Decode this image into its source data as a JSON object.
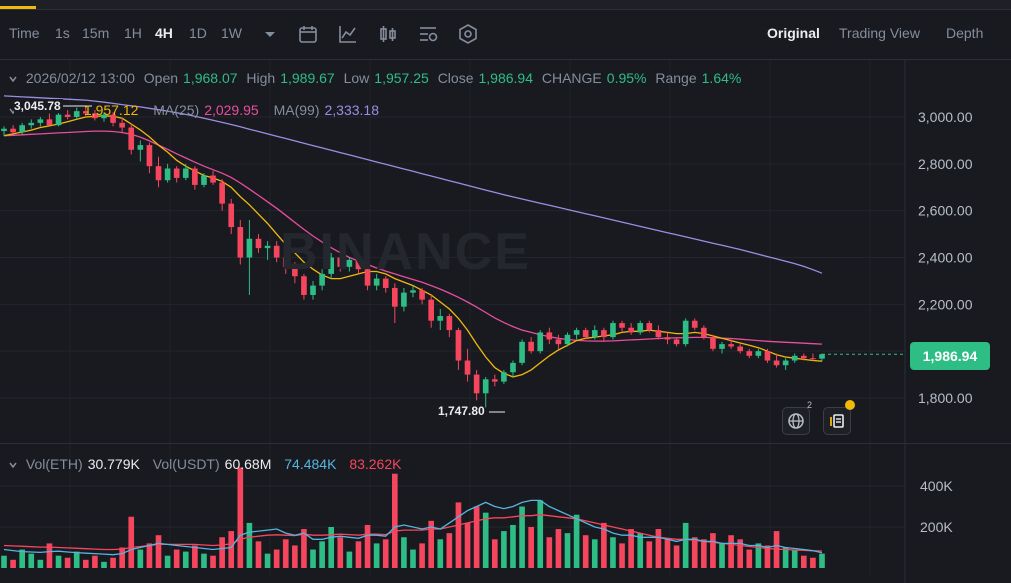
{
  "toolbar": {
    "intervals": [
      "Time",
      "1s",
      "15m",
      "1H",
      "4H",
      "1D",
      "1W"
    ],
    "active_interval": "4H",
    "views": [
      "Original",
      "Trading View",
      "Depth"
    ],
    "active_view": "Original"
  },
  "ohlc": {
    "datetime": "2026/02/12 13:00",
    "open_label": "Open",
    "open": "1,968.07",
    "high_label": "High",
    "high": "1,989.67",
    "low_label": "Low",
    "low": "1,957.25",
    "close_label": "Close",
    "close": "1,986.94",
    "change_label": "CHANGE",
    "change": "0.95%",
    "range_label": "Range",
    "range": "1.64%"
  },
  "ma": {
    "ma7_value": "1,957.12",
    "ma25_label": "MA(25)",
    "ma25_value": "2,029.95",
    "ma99_label": "MA(99)",
    "ma99_value": "2,333.18"
  },
  "volume_header": {
    "eth_label": "Vol(ETH)",
    "eth_value": "30.779K",
    "usdt_label": "Vol(USDT)",
    "usdt_value": "60.68M",
    "ma1_value": "74.484K",
    "ma2_value": "83.262K"
  },
  "price_tag": "1,986.94",
  "high_marker": "3,045.78",
  "low_marker": "1,747.80",
  "watermark": "BINANCE",
  "badge_count": "2",
  "colors": {
    "up": "#2ebd85",
    "down": "#f6465d",
    "ma7": "#f0b90b",
    "ma25": "#e84e9f",
    "ma99": "#9c8de4",
    "vol_ma1": "#56b4e0",
    "vol_ma2": "#f6465d",
    "background": "#181a20"
  },
  "chart_data": {
    "type": "candlestick",
    "y_ticks": [
      "3,000.00",
      "2,800.00",
      "2,600.00",
      "2,400.00",
      "2,200.00",
      "2,000.00",
      "1,800.00"
    ],
    "y_tick_values": [
      3000,
      2800,
      2600,
      2400,
      2200,
      2000,
      1800
    ],
    "ylim": [
      1640,
      3120
    ],
    "vol_ticks": [
      "400K",
      "200K"
    ],
    "vol_tick_values": [
      400,
      200
    ],
    "vol_ylim": [
      0,
      540
    ],
    "candles": [
      [
        2940,
        2960,
        2920,
        2950
      ],
      [
        2950,
        2965,
        2930,
        2935
      ],
      [
        2935,
        2975,
        2925,
        2965
      ],
      [
        2965,
        2990,
        2950,
        2975
      ],
      [
        2975,
        3000,
        2960,
        2990
      ],
      [
        2990,
        3015,
        2975,
        2965
      ],
      [
        2965,
        3020,
        2960,
        3010
      ],
      [
        3010,
        3030,
        2990,
        3000
      ],
      [
        3000,
        3040,
        2990,
        3025
      ],
      [
        3025,
        3046,
        3005,
        3015
      ],
      [
        3015,
        3030,
        2985,
        2995
      ],
      [
        2995,
        3020,
        2980,
        3010
      ],
      [
        3010,
        3020,
        2960,
        2975
      ],
      [
        2975,
        2995,
        2930,
        2955
      ],
      [
        2955,
        2970,
        2840,
        2860
      ],
      [
        2860,
        2900,
        2810,
        2880
      ],
      [
        2880,
        2890,
        2760,
        2790
      ],
      [
        2790,
        2830,
        2700,
        2730
      ],
      [
        2730,
        2800,
        2720,
        2780
      ],
      [
        2780,
        2790,
        2720,
        2740
      ],
      [
        2740,
        2800,
        2730,
        2780
      ],
      [
        2780,
        2790,
        2690,
        2710
      ],
      [
        2710,
        2760,
        2700,
        2750
      ],
      [
        2750,
        2770,
        2710,
        2720
      ],
      [
        2720,
        2735,
        2600,
        2630
      ],
      [
        2630,
        2650,
        2500,
        2530
      ],
      [
        2530,
        2560,
        2370,
        2400
      ],
      [
        2400,
        2560,
        2240,
        2480
      ],
      [
        2480,
        2500,
        2420,
        2440
      ],
      [
        2440,
        2470,
        2390,
        2450
      ],
      [
        2450,
        2470,
        2380,
        2400
      ],
      [
        2400,
        2420,
        2330,
        2360
      ],
      [
        2360,
        2380,
        2290,
        2320
      ],
      [
        2320,
        2330,
        2220,
        2240
      ],
      [
        2240,
        2300,
        2220,
        2280
      ],
      [
        2280,
        2350,
        2260,
        2330
      ],
      [
        2330,
        2420,
        2310,
        2400
      ],
      [
        2400,
        2410,
        2340,
        2360
      ],
      [
        2360,
        2400,
        2340,
        2390
      ],
      [
        2390,
        2400,
        2330,
        2350
      ],
      [
        2350,
        2360,
        2260,
        2280
      ],
      [
        2280,
        2330,
        2260,
        2310
      ],
      [
        2310,
        2320,
        2250,
        2270
      ],
      [
        2270,
        2290,
        2120,
        2190
      ],
      [
        2190,
        2270,
        2170,
        2250
      ],
      [
        2250,
        2280,
        2230,
        2260
      ],
      [
        2260,
        2270,
        2200,
        2220
      ],
      [
        2220,
        2240,
        2100,
        2130
      ],
      [
        2130,
        2180,
        2090,
        2150
      ],
      [
        2150,
        2160,
        2060,
        2090
      ],
      [
        2090,
        2100,
        1920,
        1960
      ],
      [
        1960,
        2010,
        1870,
        1900
      ],
      [
        1900,
        1920,
        1790,
        1820
      ],
      [
        1820,
        1890,
        1760,
        1880
      ],
      [
        1880,
        1900,
        1850,
        1870
      ],
      [
        1870,
        1920,
        1860,
        1910
      ],
      [
        1910,
        1960,
        1890,
        1950
      ],
      [
        1950,
        2050,
        1940,
        2040
      ],
      [
        2040,
        2060,
        1990,
        2000
      ],
      [
        2000,
        2090,
        1990,
        2080
      ],
      [
        2080,
        2100,
        2030,
        2050
      ],
      [
        2050,
        2070,
        2010,
        2030
      ],
      [
        2030,
        2080,
        2020,
        2070
      ],
      [
        2070,
        2100,
        2050,
        2090
      ],
      [
        2090,
        2100,
        2050,
        2060
      ],
      [
        2060,
        2110,
        2050,
        2090
      ],
      [
        2090,
        2100,
        2040,
        2060
      ],
      [
        2060,
        2130,
        2050,
        2120
      ],
      [
        2120,
        2130,
        2080,
        2100
      ],
      [
        2100,
        2120,
        2070,
        2080
      ],
      [
        2080,
        2130,
        2070,
        2120
      ],
      [
        2120,
        2130,
        2080,
        2090
      ],
      [
        2090,
        2110,
        2050,
        2060
      ],
      [
        2060,
        2080,
        2030,
        2050
      ],
      [
        2050,
        2060,
        2020,
        2030
      ],
      [
        2030,
        2140,
        2020,
        2130
      ],
      [
        2130,
        2140,
        2090,
        2100
      ],
      [
        2100,
        2110,
        2050,
        2060
      ],
      [
        2060,
        2070,
        2000,
        2010
      ],
      [
        2010,
        2040,
        1990,
        2030
      ],
      [
        2030,
        2050,
        2010,
        2020
      ],
      [
        2020,
        2030,
        1990,
        2000
      ],
      [
        2000,
        2010,
        1970,
        1980
      ],
      [
        1980,
        2010,
        1970,
        2000
      ],
      [
        2000,
        2010,
        1950,
        1960
      ],
      [
        1960,
        1990,
        1930,
        1940
      ],
      [
        1940,
        1970,
        1920,
        1960
      ],
      [
        1960,
        1990,
        1950,
        1980
      ],
      [
        1980,
        1990,
        1960,
        1970
      ],
      [
        1970,
        1990,
        1960,
        1968
      ],
      [
        1968,
        1990,
        1957,
        1987
      ]
    ],
    "volumes": [
      60,
      40,
      90,
      70,
      40,
      120,
      60,
      50,
      80,
      40,
      60,
      30,
      50,
      100,
      250,
      90,
      120,
      160,
      60,
      90,
      80,
      110,
      70,
      60,
      150,
      180,
      490,
      220,
      130,
      70,
      90,
      140,
      110,
      190,
      90,
      130,
      200,
      150,
      80,
      130,
      210,
      120,
      140,
      460,
      150,
      90,
      120,
      230,
      140,
      170,
      320,
      220,
      300,
      270,
      140,
      180,
      210,
      300,
      200,
      330,
      150,
      190,
      170,
      260,
      160,
      140,
      220,
      150,
      120,
      190,
      170,
      130,
      190,
      140,
      110,
      220,
      150,
      140,
      170,
      120,
      160,
      140,
      90,
      120,
      110,
      180,
      100,
      90,
      60,
      50,
      70
    ],
    "ma7": [
      2920,
      2928,
      2936,
      2944,
      2955,
      2962,
      2970,
      2980,
      2990,
      3000,
      3003,
      3005,
      3003,
      2995,
      2970,
      2945,
      2915,
      2880,
      2850,
      2815,
      2790,
      2770,
      2750,
      2740,
      2725,
      2700,
      2660,
      2625,
      2585,
      2545,
      2500,
      2455,
      2420,
      2380,
      2350,
      2325,
      2310,
      2310,
      2320,
      2330,
      2340,
      2340,
      2330,
      2310,
      2295,
      2280,
      2260,
      2240,
      2210,
      2180,
      2140,
      2090,
      2030,
      1975,
      1930,
      1905,
      1890,
      1900,
      1920,
      1950,
      1980,
      2005,
      2025,
      2045,
      2055,
      2060,
      2065,
      2070,
      2080,
      2085,
      2085,
      2090,
      2085,
      2080,
      2075,
      2075,
      2080,
      2075,
      2065,
      2055,
      2045,
      2035,
      2025,
      2015,
      2000,
      1985,
      1975,
      1970,
      1965,
      1960,
      1957
    ],
    "ma25": [
      2920,
      2922,
      2924,
      2926,
      2928,
      2930,
      2932,
      2934,
      2936,
      2938,
      2940,
      2940,
      2938,
      2934,
      2926,
      2914,
      2898,
      2880,
      2862,
      2843,
      2825,
      2807,
      2790,
      2775,
      2760,
      2742,
      2718,
      2692,
      2665,
      2638,
      2610,
      2580,
      2550,
      2520,
      2492,
      2466,
      2442,
      2420,
      2400,
      2385,
      2370,
      2355,
      2342,
      2330,
      2318,
      2306,
      2294,
      2280,
      2265,
      2248,
      2230,
      2210,
      2188,
      2165,
      2142,
      2122,
      2105,
      2090,
      2080,
      2070,
      2062,
      2055,
      2050,
      2046,
      2044,
      2043,
      2043,
      2044,
      2046,
      2048,
      2050,
      2052,
      2054,
      2056,
      2057,
      2058,
      2059,
      2059,
      2058,
      2056,
      2054,
      2051,
      2048,
      2045,
      2042,
      2040,
      2038,
      2036,
      2034,
      2032,
      2030
    ],
    "ma99": [
      3090,
      3088,
      3086,
      3084,
      3082,
      3080,
      3078,
      3076,
      3074,
      3072,
      3068,
      3063,
      3058,
      3053,
      3048,
      3043,
      3037,
      3031,
      3025,
      3018,
      3011,
      3003,
      2995,
      2986,
      2977,
      2968,
      2958,
      2948,
      2938,
      2928,
      2918,
      2908,
      2898,
      2888,
      2878,
      2868,
      2858,
      2848,
      2838,
      2828,
      2818,
      2808,
      2798,
      2788,
      2778,
      2768,
      2758,
      2748,
      2738,
      2728,
      2718,
      2708,
      2698,
      2688,
      2678,
      2668,
      2659,
      2650,
      2641,
      2632,
      2623,
      2614,
      2605,
      2596,
      2587,
      2578,
      2569,
      2560,
      2551,
      2542,
      2533,
      2524,
      2515,
      2506,
      2497,
      2488,
      2479,
      2470,
      2461,
      2452,
      2443,
      2434,
      2424,
      2414,
      2404,
      2394,
      2384,
      2374,
      2362,
      2348,
      2333
    ],
    "vol_ma1": [
      90,
      85,
      80,
      78,
      76,
      80,
      82,
      78,
      75,
      72,
      70,
      68,
      65,
      70,
      90,
      100,
      110,
      120,
      115,
      110,
      105,
      100,
      95,
      90,
      95,
      100,
      160,
      175,
      180,
      185,
      190,
      170,
      160,
      170,
      140,
      140,
      150,
      155,
      150,
      145,
      160,
      160,
      155,
      200,
      210,
      200,
      190,
      200,
      190,
      220,
      250,
      280,
      300,
      320,
      300,
      290,
      300,
      320,
      330,
      330,
      300,
      280,
      260,
      240,
      220,
      200,
      190,
      170,
      160,
      160,
      150,
      150,
      150,
      140,
      130,
      140,
      140,
      130,
      130,
      120,
      120,
      120,
      110,
      110,
      100,
      110,
      100,
      95,
      90,
      85,
      74
    ],
    "vol_ma2": [
      110,
      108,
      106,
      104,
      102,
      102,
      100,
      98,
      96,
      94,
      92,
      90,
      90,
      92,
      100,
      105,
      110,
      115,
      115,
      115,
      115,
      115,
      112,
      110,
      112,
      118,
      140,
      150,
      155,
      160,
      162,
      160,
      158,
      165,
      160,
      160,
      162,
      165,
      163,
      160,
      165,
      165,
      163,
      180,
      185,
      185,
      185,
      190,
      190,
      200,
      210,
      220,
      230,
      240,
      245,
      245,
      250,
      255,
      255,
      260,
      255,
      250,
      245,
      240,
      230,
      220,
      210,
      200,
      190,
      180,
      170,
      160,
      150,
      145,
      140,
      140,
      135,
      130,
      125,
      120,
      115,
      110,
      105,
      100,
      95,
      92,
      90,
      88,
      86,
      84,
      83
    ]
  }
}
